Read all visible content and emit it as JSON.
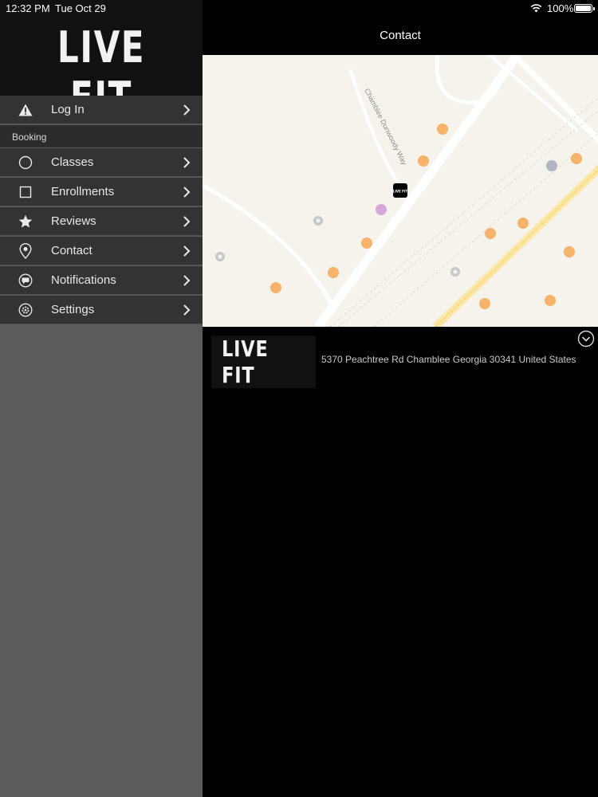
{
  "status_bar": {
    "time": "12:32 PM",
    "date": "Tue Oct 29",
    "battery_percent": "100%",
    "battery_level": 1.0
  },
  "sidebar": {
    "logo_text": "LIVE FIT",
    "login": {
      "label": "Log In",
      "icon": "warning-icon"
    },
    "section_label": "Booking",
    "items": [
      {
        "label": "Classes",
        "icon": "circle-icon"
      },
      {
        "label": "Enrollments",
        "icon": "square-icon"
      },
      {
        "label": "Reviews",
        "icon": "star-icon"
      },
      {
        "label": "Contact",
        "icon": "location-pin-icon"
      },
      {
        "label": "Notifications",
        "icon": "chat-bubble-icon"
      },
      {
        "label": "Settings",
        "icon": "gear-icon"
      }
    ]
  },
  "main": {
    "title": "Contact",
    "map": {
      "street_label": "Chamblee Dunwoody Way",
      "marker_text": "LIVE FIT",
      "colors": {
        "land": "#f6f3ec",
        "road": "#ffffff",
        "highway": "#fbe7a3",
        "poi": "#f5b36b"
      }
    },
    "location": {
      "logo_text": "LIVE FIT",
      "address": "5370 Peachtree Rd Chamblee Georgia 30341 United States"
    }
  }
}
